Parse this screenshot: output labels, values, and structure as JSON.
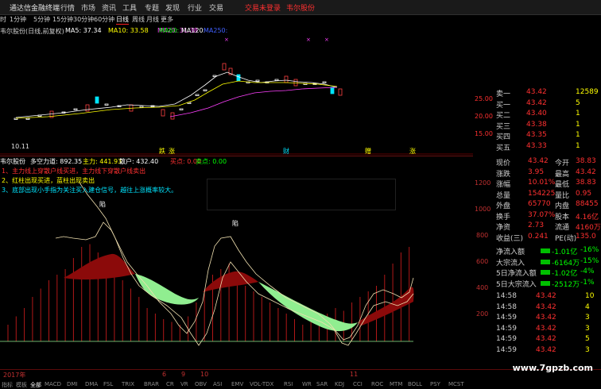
{
  "titlebar": {
    "app_name": "通达信金融终端",
    "menus": [
      "行情",
      "市场",
      "资讯",
      "工具",
      "专题",
      "发现",
      "行业",
      "交易"
    ],
    "login": "交易未登录",
    "stock_link": "韦尔股份"
  },
  "periods": [
    "1分钟",
    "5分钟",
    "15分钟",
    "30分钟",
    "60分钟",
    "日线",
    "周线",
    "月线",
    "更多"
  ],
  "selected_period": "日线",
  "ma_legend": {
    "name": "韦尔股份(日线,前复权)",
    "ma5": "MA5: 37.34",
    "ma10": "MA10: 33.58",
    "ma20": "MA20: 31.38",
    "ma60": "MA60:",
    "ma120": "MA120:",
    "ma250": "MA250:"
  },
  "kchart_labels": {
    "low_label": "10.11",
    "price_ticks": [
      "25.00",
      "20.00",
      "15.00"
    ],
    "event_marks": [
      "跌",
      "涨",
      "财",
      "赠",
      "涨"
    ]
  },
  "midstrip": {
    "name": "韦尔股份",
    "dkpower": "多空力道: 892.35",
    "main": "主力: 441.93",
    "retail": "散户: 432.40",
    "buy": "买点: 0.00",
    "sell": "卖点: 0.00"
  },
  "notes": [
    "1、主力线上穿散户线买进，主力线下穿散户线卖出",
    "2、红柱出现买进，蓝柱出现卖出",
    "3、底部出现小手指为关注买入建仓信号，越往上涨概率较大。"
  ],
  "ind_labels": {
    "mark1": "陷",
    "mark2": "陷"
  },
  "ind_ticks": [
    "1200",
    "1000",
    "800",
    "600",
    "400",
    "200"
  ],
  "xaxis": {
    "year": "2017年",
    "m1": "6",
    "m2": "9",
    "m3": "10",
    "m4": "11"
  },
  "quote": {
    "sell": [
      {
        "label": "卖一",
        "price": "43.42",
        "vol": "12589"
      },
      {
        "label": "买一",
        "price": "43.42",
        "vol": "5"
      },
      {
        "label": "买二",
        "price": "43.40",
        "vol": "1"
      },
      {
        "label": "买三",
        "price": "43.38",
        "vol": "1"
      },
      {
        "label": "买四",
        "price": "43.35",
        "vol": "1"
      },
      {
        "label": "买五",
        "price": "43.33",
        "vol": "1"
      }
    ],
    "stats": [
      {
        "l1": "现价",
        "v1": "43.42",
        "l2": "今开",
        "v2": "38.83"
      },
      {
        "l1": "涨跌",
        "v1": "3.95",
        "l2": "最高",
        "v2": "43.42"
      },
      {
        "l1": "涨幅",
        "v1": "10.01%",
        "l2": "最低",
        "v2": "38.83"
      },
      {
        "l1": "总量",
        "v1": "154225",
        "l2": "量比",
        "v2": "0.95"
      },
      {
        "l1": "外盘",
        "v1": "65770",
        "l2": "内盘",
        "v2": "88455"
      },
      {
        "l1": "换手",
        "v1": "37.07%",
        "l2": "股本",
        "v2": "4.16亿"
      },
      {
        "l1": "净资",
        "v1": "2.73",
        "l2": "流通",
        "v2": "4160万"
      },
      {
        "l1": "收益(三)",
        "v1": "0.241",
        "l2": "PE(动)",
        "v2": "135.0"
      }
    ],
    "flows": [
      {
        "label": "净流入额",
        "value": "-1.01亿",
        "pct": "-16%"
      },
      {
        "label": "大宗流入",
        "value": "-6164万",
        "pct": "-15%"
      },
      {
        "label": "5日净流入额",
        "value": "-1.02亿",
        "pct": "-4%"
      },
      {
        "label": "5日大宗流入",
        "value": "-2512万",
        "pct": "-1%"
      }
    ],
    "ticks": [
      {
        "time": "14:58",
        "price": "43.42",
        "vol": "10"
      },
      {
        "time": "14:58",
        "price": "43.42",
        "vol": "4"
      },
      {
        "time": "14:59",
        "price": "43.42",
        "vol": "3"
      },
      {
        "time": "14:59",
        "price": "43.42",
        "vol": "3"
      },
      {
        "time": "14:59",
        "price": "43.42",
        "vol": "5"
      },
      {
        "time": "14:59",
        "price": "43.42",
        "vol": "3"
      }
    ]
  },
  "bottom_tabs": [
    "指标",
    "模板",
    "全部",
    "MACD",
    "DMI",
    "DMA",
    "FSL",
    "TRIX",
    "BRAR",
    "CR",
    "VR",
    "OBV",
    "ASI",
    "EMV",
    "VOL-TDX",
    "RSI",
    "WR",
    "SAR",
    "KDJ",
    "CCI",
    "ROC",
    "MTM",
    "BOLL",
    "PSY",
    "MCST"
  ],
  "watermark": "www.7gpzb.com",
  "colors": {
    "up": "#ff2020",
    "down": "#00e5ff",
    "ma5": "#ffffff",
    "ma10": "#ffff00",
    "ma20": "#ff40ff",
    "ma60": "#00ff00",
    "ma120": "#ffffff",
    "ma250": "#4060ff",
    "red_fill": "#8b0a0a",
    "green_fill": "#90ee90"
  }
}
